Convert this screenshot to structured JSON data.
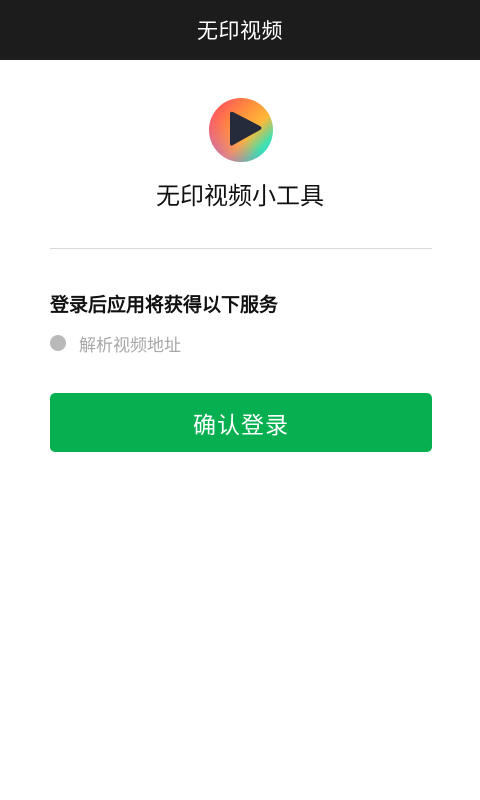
{
  "header": {
    "title": "无印视频"
  },
  "app": {
    "logo_icon": "play-icon",
    "name": "无印视频小工具"
  },
  "permissions": {
    "title": "登录后应用将获得以下服务",
    "items": [
      {
        "label": "解析视频地址"
      }
    ]
  },
  "actions": {
    "confirm_label": "确认登录"
  },
  "colors": {
    "topbar": "#1c1c1c",
    "accent_green": "#06b050",
    "muted_text": "#a8a8a8",
    "divider": "#d9d9d9"
  }
}
